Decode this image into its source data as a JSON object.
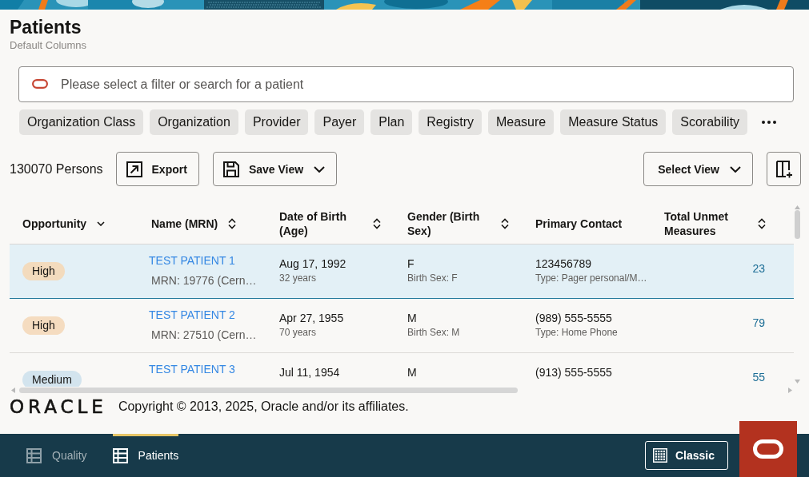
{
  "page": {
    "title": "Patients",
    "subtitle": "Default Columns"
  },
  "search": {
    "placeholder": "Please select a filter or search for a patient"
  },
  "filters": {
    "chips": [
      "Organization Class",
      "Organization",
      "Provider",
      "Payer",
      "Plan",
      "Registry",
      "Measure",
      "Measure Status",
      "Scorability"
    ],
    "more": true
  },
  "toolbar": {
    "count": "130070 Persons",
    "left_buttons": [
      {
        "kind": "export",
        "label": "Export",
        "dropdown": false
      },
      {
        "kind": "save",
        "label": "Save View",
        "dropdown": true
      }
    ],
    "right_buttons": [
      {
        "kind": "select",
        "label": "Select View",
        "dropdown": true
      },
      {
        "kind": "columns",
        "dropdown": false
      }
    ]
  },
  "table": {
    "columns": [
      {
        "label": "Opportunity",
        "kind": "menu"
      },
      {
        "label": "Name (MRN)",
        "kind": "sortable"
      },
      {
        "label": "Date of Birth (Age)",
        "kind": "sortable"
      },
      {
        "label": "Gender (Birth Sex)",
        "kind": "sortable"
      },
      {
        "label": "Primary Contact",
        "kind": "plain"
      },
      {
        "label": "Total Unmet Measures",
        "kind": "sortable"
      }
    ],
    "rows": [
      {
        "selected": true,
        "opportunity": {
          "label": "High",
          "color": "#f3dbbd"
        },
        "name": "TEST PATIENT 1",
        "mrn": "MRN: 19776 (Cern…",
        "birth_date": "Aug 17, 1992",
        "age": "32 years",
        "gender": "F",
        "birth_sex": "Birth Sex: F",
        "contact": "123456789",
        "contact_type": "Type: Pager personal/M…",
        "unmet": "23"
      },
      {
        "selected": false,
        "opportunity": {
          "label": "High",
          "color": "#f5dcc0"
        },
        "name": "TEST PATIENT 2",
        "mrn": "MRN: 27510 (Cern…",
        "birth_date": "Apr 27, 1955",
        "age": "70 years",
        "gender": "M",
        "birth_sex": "Birth Sex: M",
        "contact": "(989) 555-5555",
        "contact_type": "Type: Home Phone",
        "unmet": "79"
      },
      {
        "selected": false,
        "opportunity": {
          "label": "Medium",
          "color": "#d3e4ee"
        },
        "name": "TEST PATIENT 3",
        "birth_date": "Jul 11, 1954",
        "gender": "M",
        "contact": "(913) 555-5555",
        "unmet": "55"
      }
    ]
  },
  "footer": {
    "logo": "ORACLE",
    "copyright": "Copyright © 2013, 2025, Oracle and/or its affiliates."
  },
  "nav": {
    "tabs": [
      {
        "label": "Quality",
        "selected": false
      },
      {
        "label": "Patients",
        "selected": true
      }
    ],
    "classic_button": "Classic"
  }
}
